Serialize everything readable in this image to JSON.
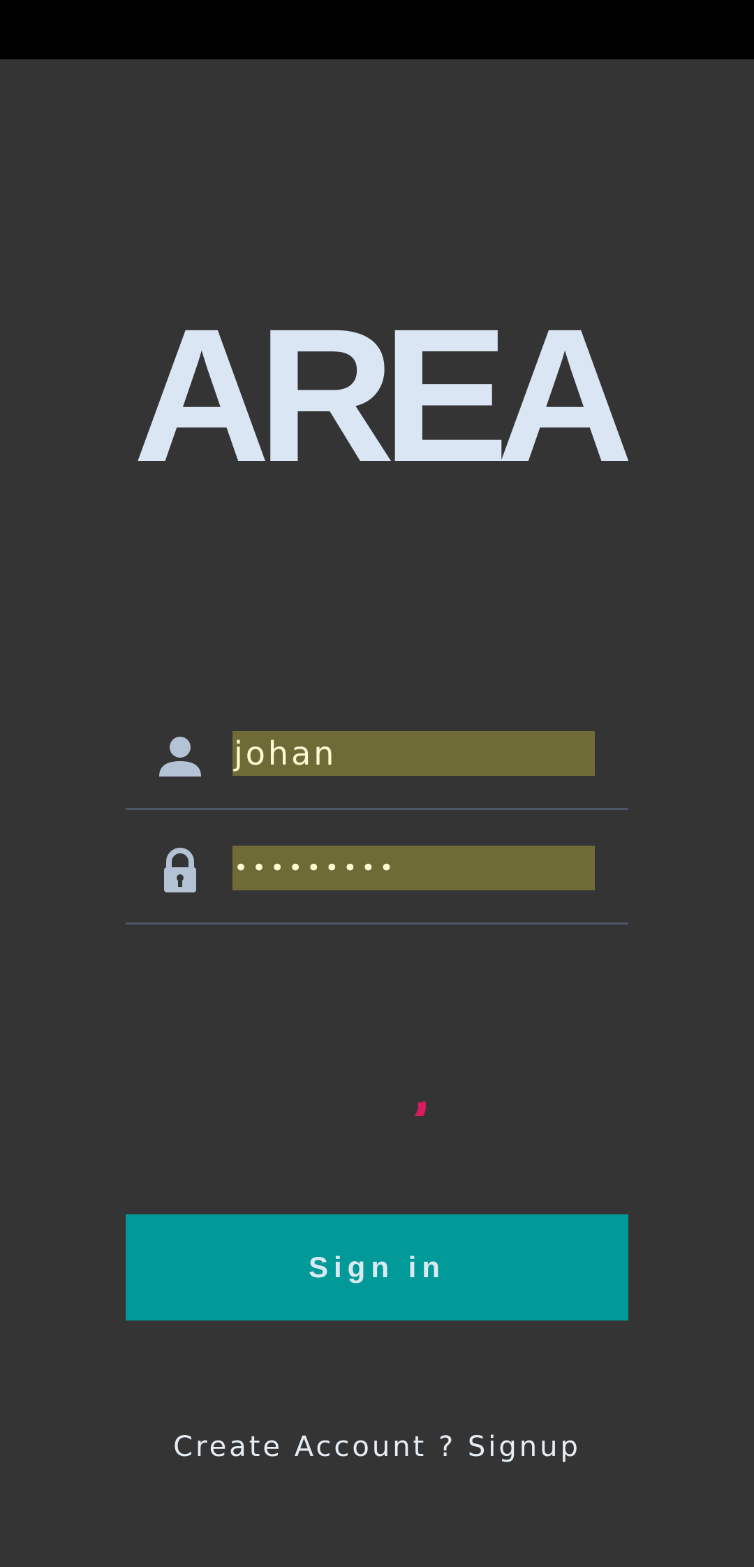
{
  "app": {
    "logo_text": "AREA"
  },
  "login": {
    "username_icon": "user-icon",
    "username_value": "johan",
    "password_icon": "lock-icon",
    "password_value": "•••••••••"
  },
  "loading": {
    "indicator": "spinner-icon"
  },
  "actions": {
    "signin_label": "Sign in",
    "signup_label": "Create Account ? Signup"
  },
  "colors": {
    "background": "#343434",
    "status_bar": "#000000",
    "logo": "#dbe6f4",
    "field_fill": "#6e6b37",
    "field_text": "#fffbd2",
    "icon": "#b4c2d6",
    "underline": "#4d5769",
    "spinner": "#d81b60",
    "button": "#019a98",
    "button_text": "#dbe9f2",
    "link_text": "#e6eef5"
  }
}
